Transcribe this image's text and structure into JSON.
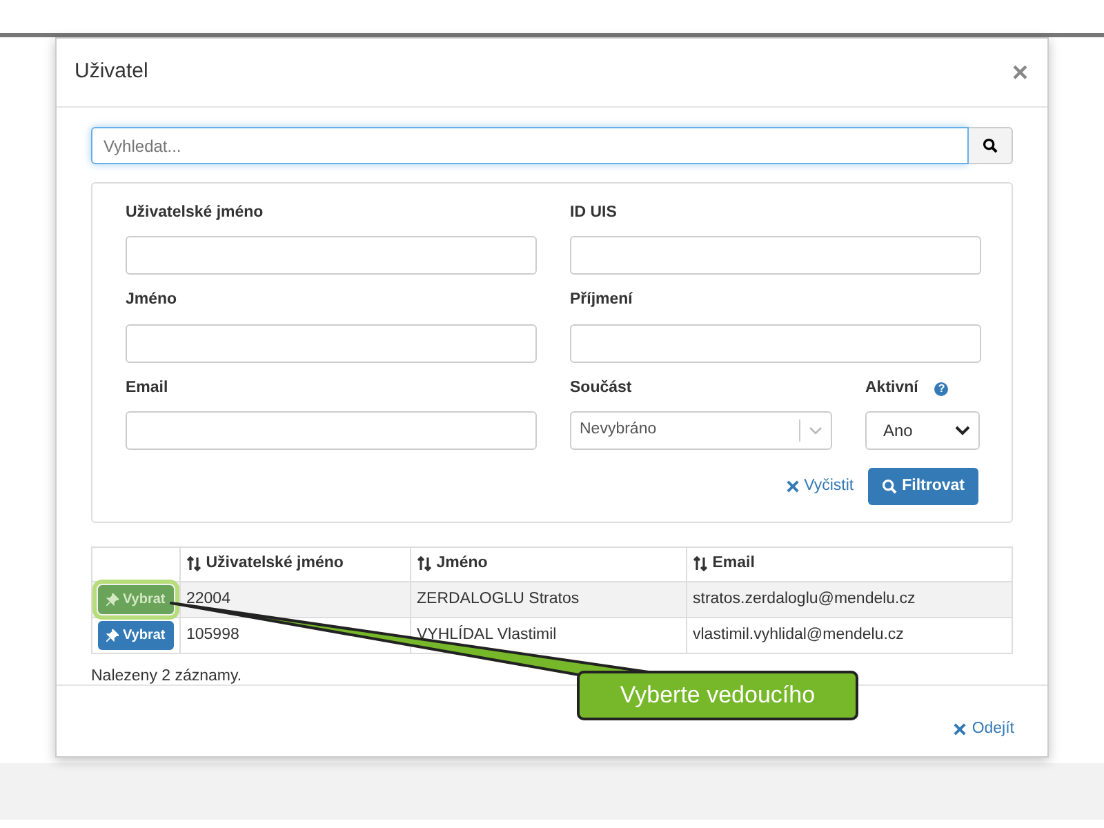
{
  "dialog": {
    "title": "Uživatel",
    "close": "×"
  },
  "search": {
    "placeholder": "Vyhledat..."
  },
  "filters": [
    {
      "kind": "text",
      "label": "Uživatelské jméno"
    },
    {
      "kind": "text",
      "label": "ID UIS"
    },
    {
      "kind": "text",
      "label": "Jméno"
    },
    {
      "kind": "text",
      "label": "Příjmení"
    },
    {
      "kind": "text",
      "label": "Email"
    },
    {
      "kind": "combo",
      "label": "Součást",
      "value": "Nevybráno"
    },
    {
      "kind": "select",
      "label": "Aktivní",
      "value": "Ano",
      "help": "?"
    }
  ],
  "clear_button": "Vyčistit",
  "filter_button": "Filtrovat",
  "table": {
    "columns": [
      "Uživatelské jméno",
      "Jméno",
      "Email"
    ],
    "rows": [
      {
        "action": "Vybrat",
        "highlighted": true,
        "cells": [
          "22004",
          "ZERDALOGLU Stratos",
          "stratos.zerdaloglu@mendelu.cz"
        ]
      },
      {
        "action": "Vybrat",
        "highlighted": false,
        "cells": [
          "105998",
          "VYHLÍDAL Vlastimil",
          "vlastimil.vyhlidal@mendelu.cz"
        ]
      }
    ]
  },
  "result_count": "Nalezeny 2 záznamy.",
  "callout": "Vyberte vedoucího",
  "leave_button": "Odejít"
}
